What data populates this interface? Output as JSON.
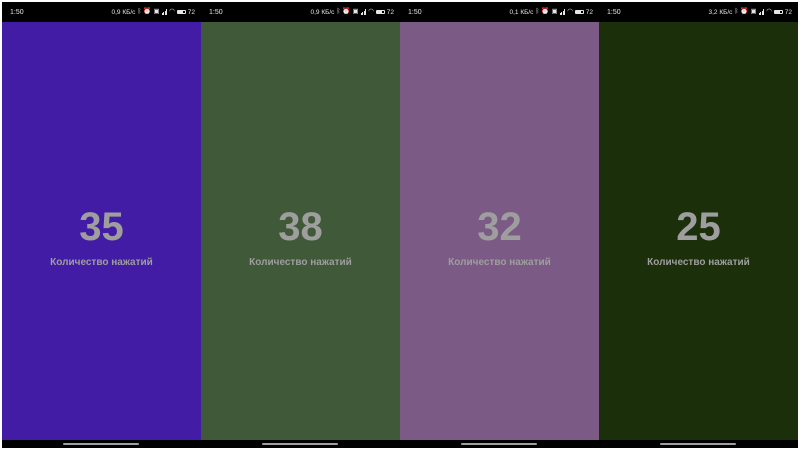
{
  "panels": [
    {
      "time": "1:50",
      "speed": "0,9 КБ/с",
      "battery": "72",
      "count": "35",
      "label": "Количество нажатий",
      "background": "#431ca5"
    },
    {
      "time": "1:50",
      "speed": "0,9 КБ/с",
      "battery": "72",
      "count": "38",
      "label": "Количество нажатий",
      "background": "#3f5939"
    },
    {
      "time": "1:50",
      "speed": "0,1 КБ/с",
      "battery": "72",
      "count": "32",
      "label": "Количество нажатий",
      "background": "#7c5a86"
    },
    {
      "time": "1:50",
      "speed": "3,2 КБ/с",
      "battery": "72",
      "count": "25",
      "label": "Количество нажатий",
      "background": "#1b2f0a"
    }
  ],
  "icons": {
    "bluetooth": "bluetooth-icon",
    "alarm": "alarm-icon",
    "sim": "sim-icon",
    "signal": "signal-icon",
    "wifi": "wifi-icon",
    "battery": "battery-icon"
  }
}
